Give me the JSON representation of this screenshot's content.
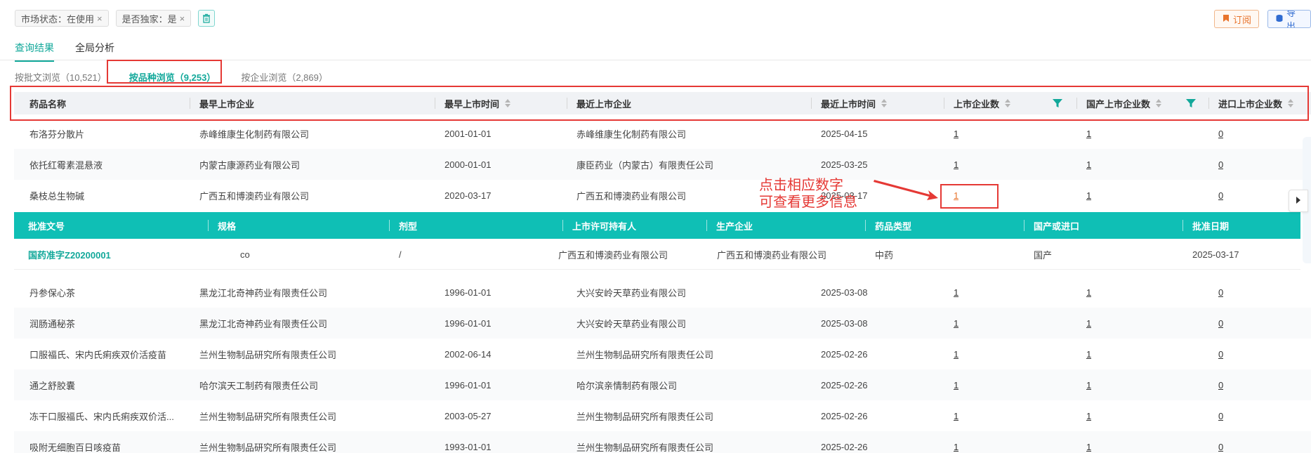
{
  "filters": {
    "chips": [
      {
        "label": "市场状态：在使用"
      },
      {
        "label": "是否独家：是"
      }
    ],
    "clear_icon": "trash-icon",
    "close_glyph": "×"
  },
  "actions": {
    "subscribe": "订阅",
    "export": "导出"
  },
  "tabs": [
    {
      "label": "查询结果",
      "active": true
    },
    {
      "label": "全局分析",
      "active": false
    }
  ],
  "subtabs": [
    {
      "label": "按批文浏览（10,521）",
      "active": false
    },
    {
      "label": "按品种浏览（9,253）",
      "active": true
    },
    {
      "label": "按企业浏览（2,869）",
      "active": false
    }
  ],
  "table": {
    "columns": [
      "药品名称",
      "最早上市企业",
      "最早上市时间",
      "最近上市企业",
      "最近上市时间",
      "上市企业数",
      "国产上市企业数",
      "进口上市企业数"
    ],
    "rows_top": [
      [
        "布洛芬分散片",
        "赤峰维康生化制药有限公司",
        "2001-01-01",
        "赤峰维康生化制药有限公司",
        "2025-04-15",
        "1",
        "1",
        "0"
      ],
      [
        "依托红霉素混悬液",
        "内蒙古康源药业有限公司",
        "2000-01-01",
        "康臣药业（内蒙古）有限责任公司",
        "2025-03-25",
        "1",
        "1",
        "0"
      ],
      [
        "桑枝总生物碱",
        "广西五和博澳药业有限公司",
        "2020-03-17",
        "广西五和博澳药业有限公司",
        "2025-03-17",
        "1",
        "1",
        "0"
      ]
    ],
    "rows_bottom": [
      [
        "丹参保心茶",
        "黑龙江北奇神药业有限责任公司",
        "1996-01-01",
        "大兴安岭天草药业有限公司",
        "2025-03-08",
        "1",
        "1",
        "0"
      ],
      [
        "润肠通秘茶",
        "黑龙江北奇神药业有限责任公司",
        "1996-01-01",
        "大兴安岭天草药业有限公司",
        "2025-03-08",
        "1",
        "1",
        "0"
      ],
      [
        "口服福氏、宋内氏痢疾双价活疫苗",
        "兰州生物制品研究所有限责任公司",
        "2002-06-14",
        "兰州生物制品研究所有限责任公司",
        "2025-02-26",
        "1",
        "1",
        "0"
      ],
      [
        "通之舒胶囊",
        "哈尔滨天工制药有限责任公司",
        "1996-01-01",
        "哈尔滨亲情制药有限公司",
        "2025-02-26",
        "1",
        "1",
        "0"
      ],
      [
        "冻干口服福氏、宋内氏痢疾双价活...",
        "兰州生物制品研究所有限责任公司",
        "2003-05-27",
        "兰州生物制品研究所有限责任公司",
        "2025-02-26",
        "1",
        "1",
        "0"
      ],
      [
        "吸附无细胞百日咳疫苗",
        "兰州生物制品研究所有限责任公司",
        "1993-01-01",
        "兰州生物制品研究所有限责任公司",
        "2025-02-26",
        "1",
        "1",
        "0"
      ]
    ]
  },
  "subtable": {
    "columns": [
      "批准文号",
      "规格",
      "剂型",
      "上市许可持有人",
      "生产企业",
      "药品类型",
      "国产或进口",
      "批准日期"
    ],
    "row": [
      "国药准字Z20200001",
      "co",
      "/",
      "广西五和博澳药业有限公司",
      "广西五和博澳药业有限公司",
      "中药",
      "国产",
      "2025-03-17"
    ]
  },
  "annotation": {
    "line1": "点击相应数字",
    "line2": "可查看更多信息"
  },
  "colors": {
    "accent": "#12a89a",
    "subheader": "#0fbfb5",
    "highlight": "#e53935",
    "orange": "#e8742d"
  }
}
